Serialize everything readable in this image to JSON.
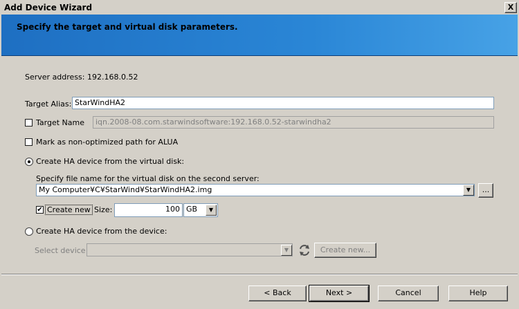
{
  "window": {
    "title": "Add Device Wizard",
    "close_glyph": "X"
  },
  "banner": {
    "text": "Specify the target and virtual disk parameters."
  },
  "server": {
    "label": "Server address: 192.168.0.52"
  },
  "alias": {
    "label": "Target Alias:",
    "value": "StarWindHA2"
  },
  "target_name": {
    "label": "Target Name",
    "value": "iqn.2008-08.com.starwindsoftware:192.168.0.52-starwindha2",
    "checked": false
  },
  "alua": {
    "label": "Mark as non-optimized path for ALUA",
    "checked": false
  },
  "virtual_disk": {
    "radio_label": "Create HA device from the virtual disk:",
    "selected": true,
    "file_label": "Specify file name for the virtual disk on the second server:",
    "file_value": "My Computer¥C¥StarWind¥StarWindHA2.img",
    "browse_label": "...",
    "create_new_label": "Create new",
    "create_new_checked": true,
    "size_label": "Size:",
    "size_value": "100",
    "size_unit": "GB"
  },
  "device": {
    "radio_label": "Create HA device from the device:",
    "selected": false,
    "select_label": "Select device",
    "select_value": "",
    "create_new_button": "Create new..."
  },
  "footer": {
    "back": "< Back",
    "next": "Next >",
    "cancel": "Cancel",
    "help": "Help"
  }
}
